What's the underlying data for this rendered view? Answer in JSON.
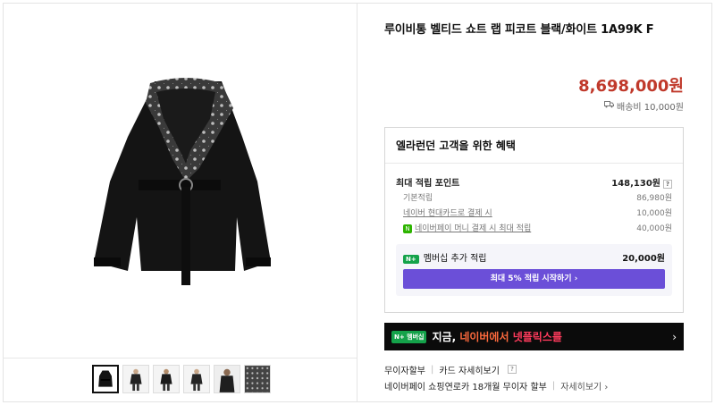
{
  "product": {
    "title": "루이비통 벨티드 쇼트 랩 피코트 블랙/화이트 1A99K F",
    "price": "8,698,000원",
    "shipping_icon": "truck-icon",
    "shipping": "배송비 10,000원"
  },
  "benefits": {
    "title": "엘라런던 고객을 위한 혜택",
    "max_points_label": "최대 적립 포인트",
    "max_points_value": "148,130원",
    "help": "?",
    "rows": [
      {
        "label": "기본적립",
        "value": "86,980원"
      },
      {
        "label": "네이버 현대카드로 결제 시",
        "value": "10,000원"
      },
      {
        "label": "네이버페이 머니 결제 시 최대 적립",
        "value": "40,000원"
      }
    ],
    "npay_badge": "N",
    "member": {
      "badge": "N+",
      "label": "멤버십 추가 적립",
      "value": "20,000원",
      "button": "최대 5% 적립 시작하기 ›"
    }
  },
  "banner": {
    "badge": "N+ 멤버십",
    "text_prefix": "지금,",
    "text_mid": "네이버에서",
    "text_highlight": "넷플릭스를",
    "arrow": "›"
  },
  "footer": {
    "installment_label": "무이자할부",
    "card_detail": "카드 자세히보기",
    "q": "?",
    "npay_line": "네이버페이 쇼핑연로카 18개월 무이자 할부",
    "detail_link": "자세히보기 ›"
  },
  "gallery": {
    "thumbnail_count": 6,
    "active_index": 0
  }
}
